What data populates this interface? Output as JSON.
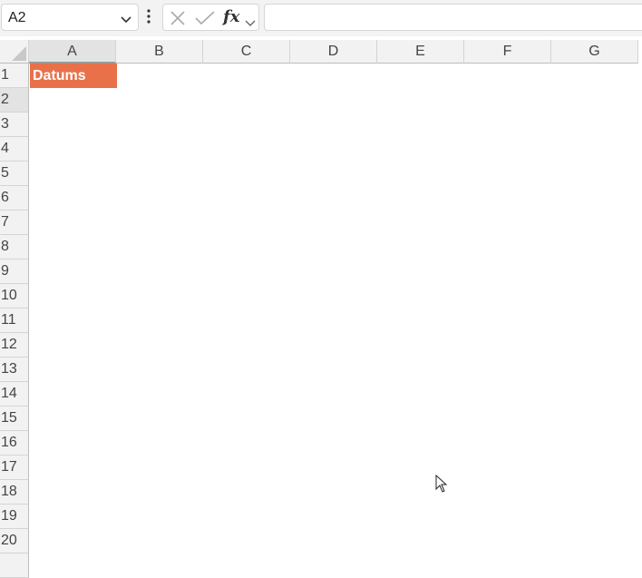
{
  "formula_bar": {
    "name_box": "A2",
    "formula": "",
    "fx_label": "fx"
  },
  "columns": [
    "A",
    "B",
    "C",
    "D",
    "E",
    "F",
    "G"
  ],
  "rows": [
    "1",
    "2",
    "3",
    "4",
    "5",
    "6",
    "7",
    "8",
    "9",
    "10",
    "11",
    "12",
    "13",
    "14",
    "15",
    "16",
    "17",
    "18",
    "19",
    "20"
  ],
  "cells": {
    "A1": "Datums"
  },
  "colors": {
    "header_fill": "#e8714a",
    "header_text": "#ffffff"
  },
  "icons": [
    "chevron-down-icon",
    "more-vertical-icon",
    "cancel-icon",
    "confirm-icon",
    "function-icon"
  ]
}
